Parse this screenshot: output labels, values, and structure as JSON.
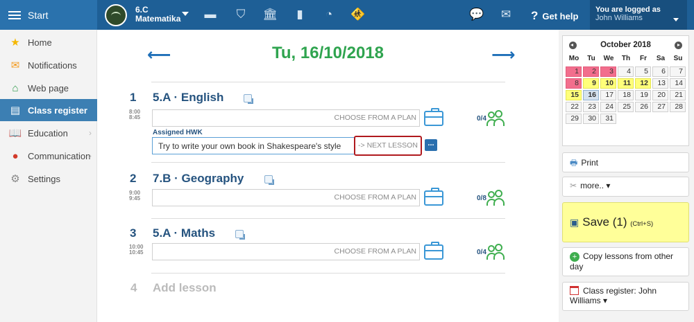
{
  "topbar": {
    "start_label": "Start",
    "class_name": "6.C",
    "subject": "Matematika",
    "help_label": "Get help",
    "logged_label": "You are logged as",
    "user_name": "John Williams"
  },
  "sidebar": {
    "items": [
      {
        "label": "Home",
        "icon": "star-icon"
      },
      {
        "label": "Notifications",
        "icon": "envelope-icon"
      },
      {
        "label": "Web page",
        "icon": "house-icon"
      },
      {
        "label": "Class register",
        "icon": "register-icon"
      },
      {
        "label": "Education",
        "icon": "book-icon"
      },
      {
        "label": "Communication",
        "icon": "chat-icon"
      },
      {
        "label": "Settings",
        "icon": "gear-icon"
      }
    ]
  },
  "main": {
    "date_title": "Tu, 16/10/2018",
    "plan_placeholder": "CHOOSE FROM A PLAN",
    "hwk_label": "Assigned HWK",
    "hwk_text": "Try to write your own book in Shakespeare's style",
    "next_lesson": "-> NEXT LESSON",
    "more_dots": "...",
    "lessons": [
      {
        "num": "1",
        "title": "5.A · English",
        "start": "8:00",
        "end": "8:45",
        "count": "0/4"
      },
      {
        "num": "2",
        "title": "7.B · Geography",
        "start": "9:00",
        "end": "9:45",
        "count": "0/8"
      },
      {
        "num": "3",
        "title": "5.A · Maths",
        "start": "10:00",
        "end": "10:45",
        "count": "0/4"
      }
    ],
    "add_num": "4",
    "add_label": "Add lesson"
  },
  "calendar": {
    "month": "October 2018",
    "dow": [
      "Mo",
      "Tu",
      "We",
      "Th",
      "Fr",
      "Sa",
      "Su"
    ],
    "rows": [
      [
        {
          "d": "1",
          "s": "red"
        },
        {
          "d": "2",
          "s": "red"
        },
        {
          "d": "3",
          "s": "red"
        },
        {
          "d": "4",
          "s": ""
        },
        {
          "d": "5",
          "s": ""
        },
        {
          "d": "6",
          "s": ""
        },
        {
          "d": "7",
          "s": ""
        }
      ],
      [
        {
          "d": "8",
          "s": "red"
        },
        {
          "d": "9",
          "s": "yellow"
        },
        {
          "d": "10",
          "s": "yellow"
        },
        {
          "d": "11",
          "s": "yellow"
        },
        {
          "d": "12",
          "s": "yellow"
        },
        {
          "d": "13",
          "s": ""
        },
        {
          "d": "14",
          "s": ""
        }
      ],
      [
        {
          "d": "15",
          "s": "yellow"
        },
        {
          "d": "16",
          "s": "today"
        },
        {
          "d": "17",
          "s": ""
        },
        {
          "d": "18",
          "s": ""
        },
        {
          "d": "19",
          "s": ""
        },
        {
          "d": "20",
          "s": ""
        },
        {
          "d": "21",
          "s": ""
        }
      ],
      [
        {
          "d": "22",
          "s": ""
        },
        {
          "d": "23",
          "s": ""
        },
        {
          "d": "24",
          "s": ""
        },
        {
          "d": "25",
          "s": ""
        },
        {
          "d": "26",
          "s": ""
        },
        {
          "d": "27",
          "s": ""
        },
        {
          "d": "28",
          "s": ""
        }
      ],
      [
        {
          "d": "29",
          "s": ""
        },
        {
          "d": "30",
          "s": ""
        },
        {
          "d": "31",
          "s": ""
        }
      ]
    ]
  },
  "panel": {
    "print": "Print",
    "more": "more.. ▾",
    "save": "Save (1)",
    "save_shortcut": "(Ctrl+S)",
    "copy": "Copy lessons from other day",
    "class_register": "Class register: John Williams ▾"
  },
  "colors": {
    "topbar": "#1e5f96",
    "active": "#3c7fb3",
    "date_green": "#2fa44f",
    "highlight_red": "#b0191e",
    "save_yellow": "#ffff99"
  }
}
